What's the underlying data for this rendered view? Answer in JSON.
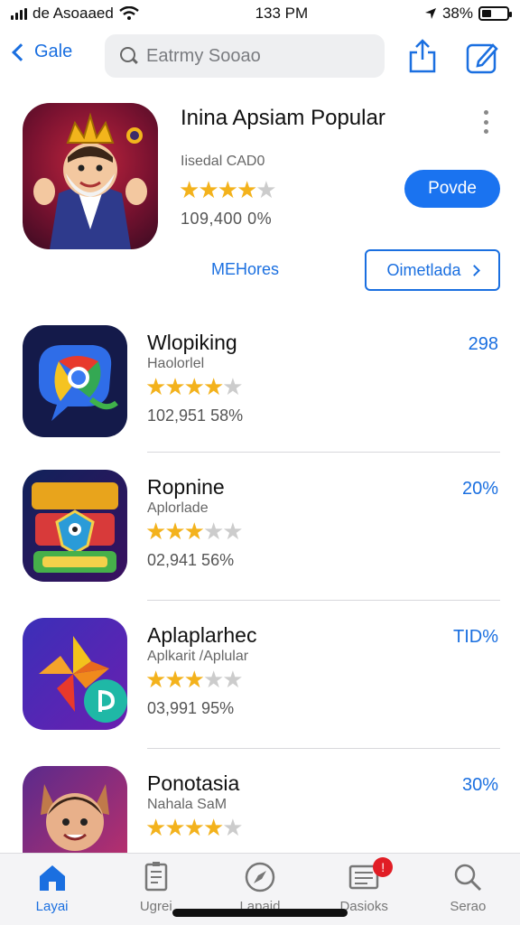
{
  "status_bar": {
    "carrier": "de Asoaaed",
    "time": "133 PM",
    "battery": "38%",
    "battery_level": 0.38
  },
  "nav": {
    "back_label": "Gale",
    "search_placeholder": "Eatrmy Sooao"
  },
  "featured": {
    "title": "Inina Apsiam Popular",
    "subtitle": "Iisedal CAD0",
    "rating": 4,
    "stats": "109,400 0%",
    "get_label": "Povde",
    "more_label": "MEHores",
    "outline_label": "Oimetlada"
  },
  "apps": [
    {
      "name": "Wlopiking",
      "subtitle": "Haolorlel",
      "rating": 3.5,
      "stats": "102,951 58%",
      "percent": "298"
    },
    {
      "name": "Ropnine",
      "subtitle": "Aplorlade",
      "rating": 3,
      "stats": "02,941 56%",
      "percent": "20%"
    },
    {
      "name": "Aplaplarhec",
      "subtitle": "Aplkarit /Aplular",
      "rating": 3,
      "stats": "03,991 95%",
      "percent": "TID%"
    },
    {
      "name": "Ponotasia",
      "subtitle": "Nahala SaM",
      "rating": 3.5,
      "stats": "",
      "percent": "30%"
    }
  ],
  "tabs": [
    {
      "label": "Layai",
      "icon": "house-icon",
      "active": true
    },
    {
      "label": "Ugrei",
      "icon": "document-icon",
      "active": false
    },
    {
      "label": "Lapaid",
      "icon": "compass-icon",
      "active": false
    },
    {
      "label": "Dasioks",
      "icon": "list-icon",
      "active": false,
      "badge": "!"
    },
    {
      "label": "Serao",
      "icon": "search-icon",
      "active": false
    }
  ],
  "colors": {
    "accent": "#1a73f0",
    "star": "#f3b21c",
    "badge": "#e11d25"
  }
}
